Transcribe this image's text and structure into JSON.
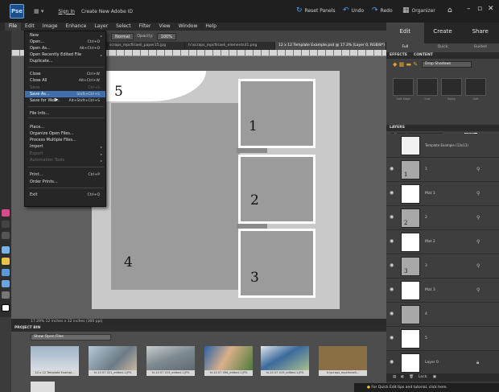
{
  "topbar": {
    "signin": "Sign In",
    "create_id": "Create New Adobe ID",
    "reset_panels": "Reset Panels",
    "undo": "Undo",
    "redo": "Redo",
    "organizer": "Organizer",
    "app_logo": "Pse"
  },
  "menubar": [
    "File",
    "Edit",
    "Image",
    "Enhance",
    "Layer",
    "Select",
    "Filter",
    "View",
    "Window",
    "Help"
  ],
  "options_bar": {
    "mode": "Normal",
    "opacity_label": "Opacity:",
    "opacity": "100%"
  },
  "doc_tabs": [
    "scraps_mpcfiriaeli_paper15.jpg",
    "h:\\scraps_mpcfiriaeli_elements41.png",
    "12 x 12 Template Example.psd @ 17.3% (Layer 0, RGB/8*)"
  ],
  "file_menu": {
    "items": [
      {
        "label": "New",
        "shortcut": "",
        "state": "normal",
        "submenu": true
      },
      {
        "label": "Open...",
        "shortcut": "Ctrl+O",
        "state": "normal",
        "submenu": false
      },
      {
        "label": "Open As...",
        "shortcut": "Alt+Ctrl+O",
        "state": "normal",
        "submenu": false
      },
      {
        "label": "Open Recently Edited File",
        "shortcut": "",
        "state": "normal",
        "submenu": true
      },
      {
        "label": "Duplicate...",
        "shortcut": "",
        "state": "normal",
        "submenu": false
      },
      {
        "label": "Close",
        "shortcut": "Ctrl+W",
        "state": "normal",
        "submenu": false
      },
      {
        "label": "Close All",
        "shortcut": "Alt+Ctrl+W",
        "state": "normal",
        "submenu": false
      },
      {
        "label": "Save",
        "shortcut": "Ctrl+S",
        "state": "disabled",
        "submenu": false
      },
      {
        "label": "Save As...",
        "shortcut": "Shift+Ctrl+S",
        "state": "highlighted",
        "submenu": false
      },
      {
        "label": "Save for Web...",
        "shortcut": "Alt+Shift+Ctrl+S",
        "state": "normal",
        "submenu": false
      },
      {
        "label": "File Info...",
        "shortcut": "",
        "state": "normal",
        "submenu": false
      },
      {
        "label": "Place...",
        "shortcut": "",
        "state": "normal",
        "submenu": false
      },
      {
        "label": "Organize Open Files...",
        "shortcut": "",
        "state": "normal",
        "submenu": false
      },
      {
        "label": "Process Multiple Files...",
        "shortcut": "",
        "state": "normal",
        "submenu": false
      },
      {
        "label": "Import",
        "shortcut": "",
        "state": "normal",
        "submenu": true
      },
      {
        "label": "Export",
        "shortcut": "",
        "state": "disabled",
        "submenu": true
      },
      {
        "label": "Automation Tools",
        "shortcut": "",
        "state": "disabled",
        "submenu": true
      },
      {
        "label": "Print...",
        "shortcut": "Ctrl+P",
        "state": "normal",
        "submenu": false
      },
      {
        "label": "Order Prints...",
        "shortcut": "",
        "state": "normal",
        "submenu": false
      },
      {
        "label": "Exit",
        "shortcut": "Ctrl+Q",
        "state": "normal",
        "submenu": false
      }
    ]
  },
  "canvas": {
    "photo_numbers": [
      "1",
      "2",
      "3",
      "4",
      "5"
    ]
  },
  "statusbar": {
    "text": "17.29%   12 inches x 12 inches (300 ppi)"
  },
  "project_bin": {
    "title": "PROJECT BIN",
    "show": "Show Open Files",
    "items": [
      "12 x 12 Template Exampl...",
      "hi-10 07 021_edited-1.JPG",
      "hi-10 07 019_edited-1.JPG",
      "hi-10 07 096_edited-1.JPG",
      "hi-10 07 019_edited-1.JPG",
      "h:\\scraps_mpcfiriaeli..."
    ]
  },
  "right_panel": {
    "mode_tabs": [
      "Edit",
      "Create",
      "Share"
    ],
    "sub_tabs": [
      "Full",
      "Quick",
      "Guided"
    ],
    "effects_tabs": [
      "EFFECTS",
      "CONTENT"
    ],
    "effects_dropdown": "Drop Shadows",
    "fx_labels": [
      "Soft Edge",
      "Low",
      "Noisy",
      "Soft"
    ],
    "layers_title": "LAYERS",
    "blend": "Normal",
    "opacity_label": "Opacity:",
    "opacity": "100%",
    "top_layer_name": "Template Example (13x13)",
    "layers": [
      {
        "name": "1",
        "num": "1",
        "thumb": "gray"
      },
      {
        "name": "Mat 1",
        "num": "",
        "thumb": "white"
      },
      {
        "name": "2",
        "num": "2",
        "thumb": "gray"
      },
      {
        "name": "Mat 2",
        "num": "",
        "thumb": "white"
      },
      {
        "name": "3",
        "num": "3",
        "thumb": "gray"
      },
      {
        "name": "Mat 3",
        "num": "",
        "thumb": "white"
      },
      {
        "name": "4",
        "num": "",
        "thumb": "gray"
      },
      {
        "name": "5",
        "num": "",
        "thumb": "white"
      },
      {
        "name": "Layer 0",
        "num": "",
        "thumb": "white"
      }
    ],
    "footer": "Lock:",
    "quick_tip": "For Quick Edit tips and tutorial, click here."
  }
}
